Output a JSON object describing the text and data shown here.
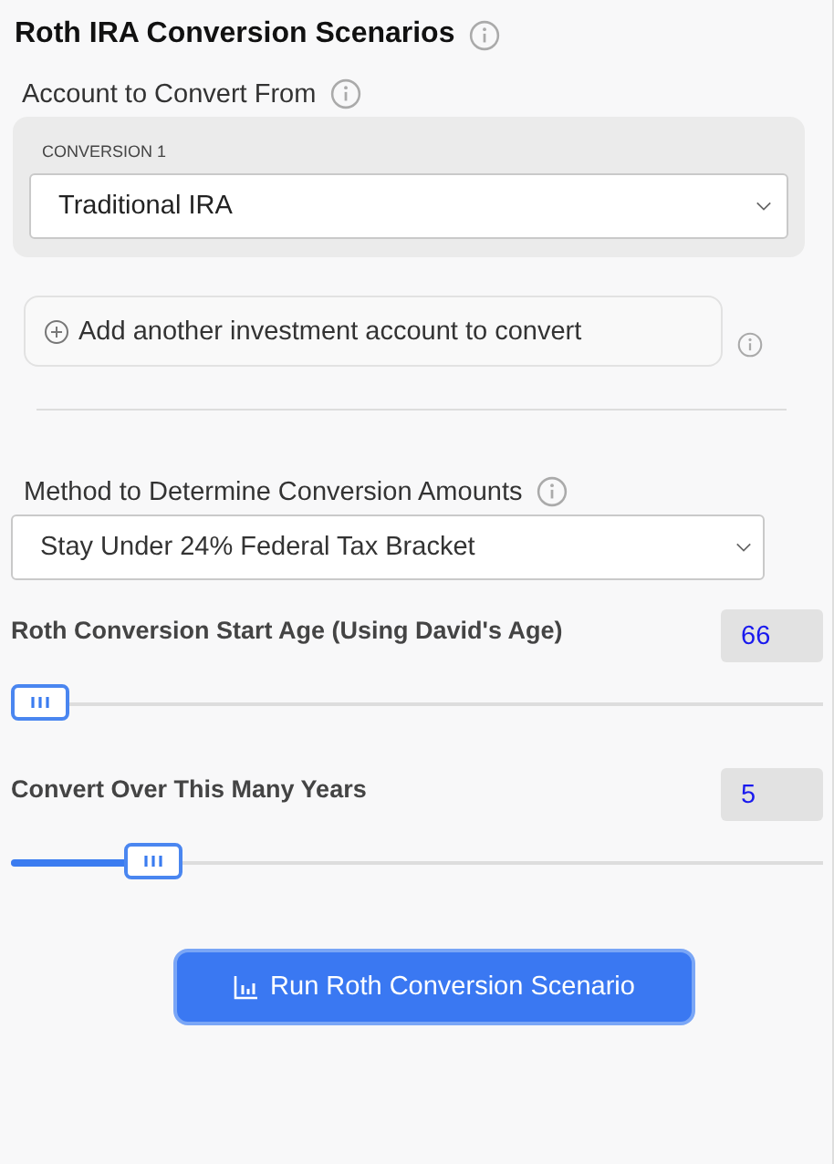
{
  "title": "Roth IRA Conversion Scenarios",
  "account_section": {
    "label": "Account to Convert From",
    "conversions": [
      {
        "label": "CONVERSION 1",
        "value": "Traditional IRA"
      }
    ],
    "add_button": "Add another investment account to convert"
  },
  "method": {
    "label": "Method to Determine Conversion Amounts",
    "value": "Stay Under 24% Federal Tax Bracket"
  },
  "sliders": [
    {
      "label": "Roth Conversion Start Age (Using David's Age)",
      "value": "66",
      "level": 0
    },
    {
      "label": "Convert Over This Many Years",
      "value": "5",
      "level": 0.15
    }
  ],
  "run_button": "Run Roth Conversion Scenario"
}
